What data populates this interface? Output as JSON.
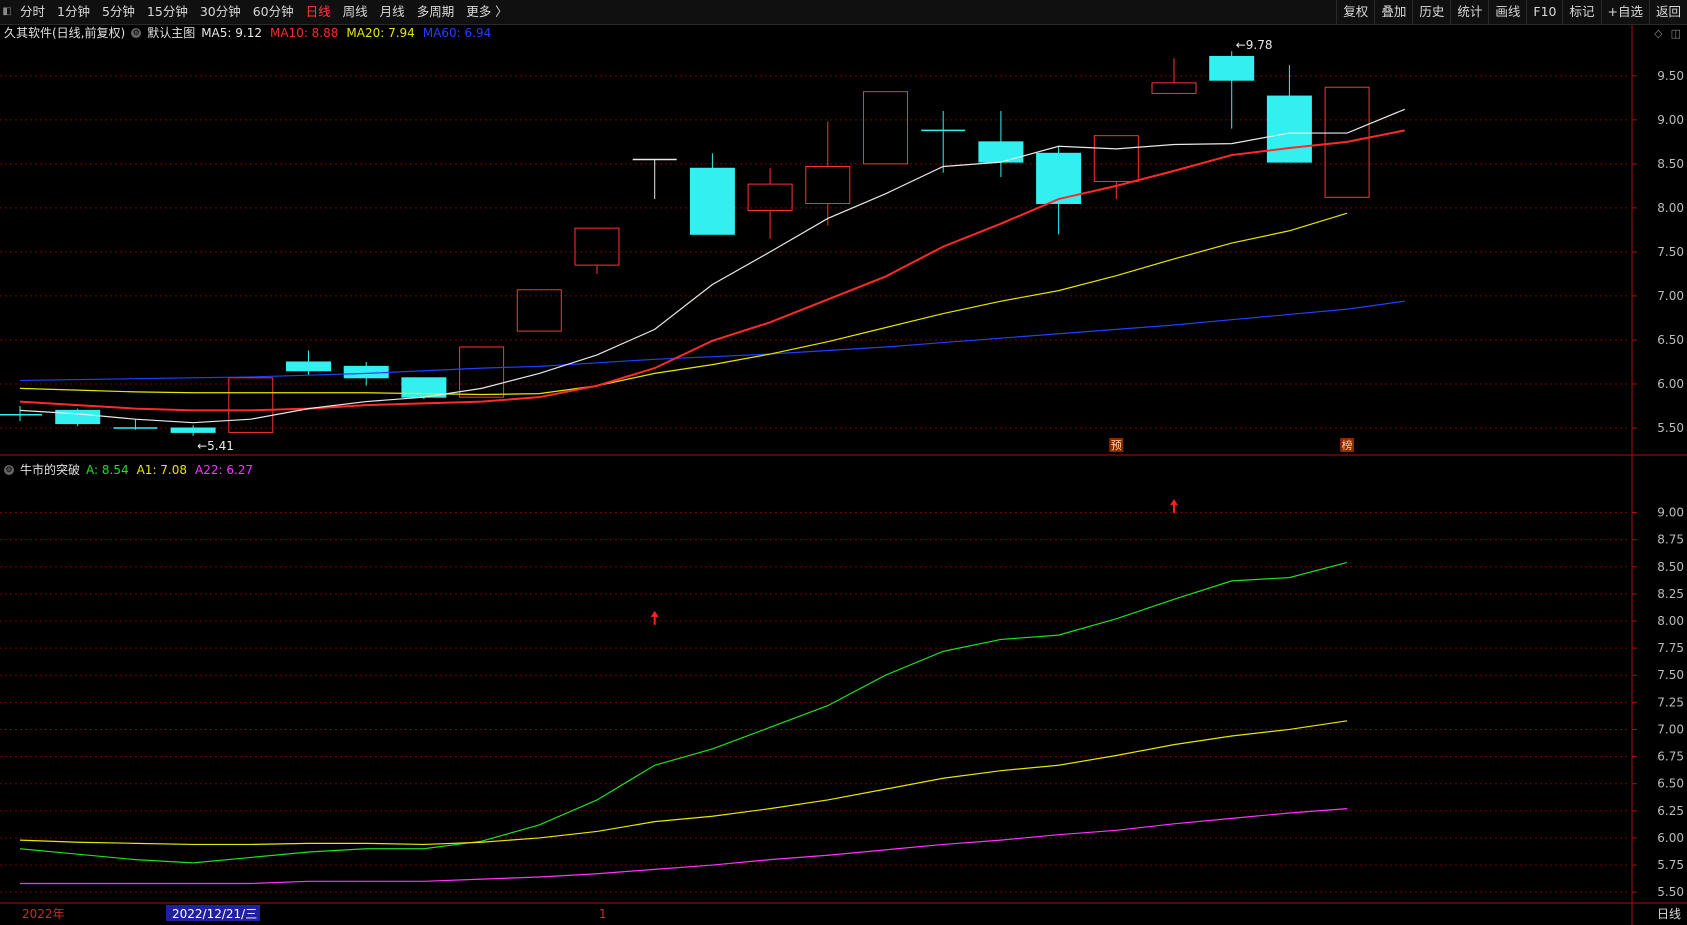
{
  "toolbar": {
    "left_items": [
      {
        "label": "分时",
        "active": false
      },
      {
        "label": "1分钟",
        "active": false
      },
      {
        "label": "5分钟",
        "active": false
      },
      {
        "label": "15分钟",
        "active": false
      },
      {
        "label": "30分钟",
        "active": false
      },
      {
        "label": "60分钟",
        "active": false
      },
      {
        "label": "日线",
        "active": true
      },
      {
        "label": "周线",
        "active": false
      },
      {
        "label": "月线",
        "active": false
      },
      {
        "label": "多周期",
        "active": false
      },
      {
        "label": "更多 〉",
        "active": false
      }
    ],
    "right_items": [
      "复权",
      "叠加",
      "历史",
      "统计",
      "画线",
      "F10",
      "标记",
      "+自选",
      "返回"
    ]
  },
  "main_legend": {
    "title": "久其软件(日线,前复权)",
    "template": "默认主图",
    "ma": [
      {
        "label": "MA5: 9.12",
        "color": "#e8e8e8"
      },
      {
        "label": "MA10: 8.88",
        "color": "#ff2a2a"
      },
      {
        "label": "MA20: 7.94",
        "color": "#e6e600"
      },
      {
        "label": "MA60: 6.94",
        "color": "#2040ff"
      }
    ]
  },
  "indicator_legend": {
    "title": "牛市的突破",
    "items": [
      {
        "label": "A: 8.54",
        "color": "#22dd22"
      },
      {
        "label": "A1: 7.08",
        "color": "#e6e600"
      },
      {
        "label": "A22: 6.27",
        "color": "#ff33ff"
      }
    ]
  },
  "bottom_period": "日线",
  "colors": {
    "up": "#ff3333",
    "down": "#33f0f0",
    "grid": "#7a0000",
    "axis": "#aa1010"
  },
  "chart_data": [
    {
      "type": "candlestick",
      "name": "main",
      "ylim": [
        5.25,
        9.85
      ],
      "yticks": [
        "9.50",
        "9.00",
        "8.50",
        "8.00",
        "7.50",
        "7.00",
        "6.50",
        "6.00",
        "5.50"
      ],
      "candles": [
        {
          "o": 5.65,
          "c": 5.65,
          "h": 5.75,
          "l": 5.58
        },
        {
          "o": 5.7,
          "c": 5.55,
          "h": 5.72,
          "l": 5.52
        },
        {
          "o": 5.5,
          "c": 5.5,
          "h": 5.6,
          "l": 5.48
        },
        {
          "o": 5.5,
          "c": 5.45,
          "h": 5.53,
          "l": 5.41
        },
        {
          "o": 5.45,
          "c": 6.07,
          "h": 6.07,
          "l": 5.45
        },
        {
          "o": 6.25,
          "c": 6.15,
          "h": 6.38,
          "l": 6.1
        },
        {
          "o": 6.2,
          "c": 6.07,
          "h": 6.25,
          "l": 5.98
        },
        {
          "o": 6.07,
          "c": 5.85,
          "h": 6.07,
          "l": 5.83
        },
        {
          "o": 5.85,
          "c": 6.42,
          "h": 6.42,
          "l": 5.85
        },
        {
          "o": 6.6,
          "c": 7.07,
          "h": 7.07,
          "l": 6.6
        },
        {
          "o": 7.35,
          "c": 7.77,
          "h": 7.77,
          "l": 7.25
        },
        {
          "o": 8.55,
          "c": 8.55,
          "h": 8.55,
          "l": 8.1
        },
        {
          "o": 8.45,
          "c": 7.7,
          "h": 8.62,
          "l": 7.7
        },
        {
          "o": 7.97,
          "c": 8.27,
          "h": 8.45,
          "l": 7.65
        },
        {
          "o": 8.05,
          "c": 8.47,
          "h": 8.98,
          "l": 7.8
        },
        {
          "o": 8.5,
          "c": 9.32,
          "h": 9.32,
          "l": 8.5
        },
        {
          "o": 8.88,
          "c": 8.88,
          "h": 9.1,
          "l": 8.4
        },
        {
          "o": 8.75,
          "c": 8.52,
          "h": 9.1,
          "l": 8.35
        },
        {
          "o": 8.62,
          "c": 8.05,
          "h": 8.7,
          "l": 7.7
        },
        {
          "o": 8.3,
          "c": 8.82,
          "h": 8.82,
          "l": 8.1
        },
        {
          "o": 9.3,
          "c": 9.42,
          "h": 9.7,
          "l": 9.3
        },
        {
          "o": 9.72,
          "c": 9.45,
          "h": 9.78,
          "l": 8.9
        },
        {
          "o": 9.27,
          "c": 8.52,
          "h": 9.62,
          "l": 8.52
        },
        {
          "o": 8.12,
          "c": 9.37,
          "h": 9.37,
          "l": 8.12
        }
      ],
      "ma5": [
        5.7,
        5.66,
        5.6,
        5.56,
        5.6,
        5.72,
        5.8,
        5.85,
        5.95,
        6.12,
        6.33,
        6.62,
        7.13,
        7.5,
        7.88,
        8.16,
        8.47,
        8.52,
        8.7,
        8.67,
        8.72,
        8.73,
        8.85,
        8.85,
        9.12
      ],
      "ma10": [
        5.8,
        5.76,
        5.72,
        5.7,
        5.7,
        5.72,
        5.76,
        5.78,
        5.8,
        5.85,
        5.98,
        6.18,
        6.49,
        6.7,
        6.96,
        7.22,
        7.56,
        7.82,
        8.1,
        8.25,
        8.42,
        8.6,
        8.68,
        8.75,
        8.88
      ],
      "ma20": [
        5.95,
        5.93,
        5.91,
        5.9,
        5.9,
        5.9,
        5.9,
        5.89,
        5.88,
        5.89,
        5.98,
        6.12,
        6.22,
        6.34,
        6.48,
        6.64,
        6.8,
        6.94,
        7.06,
        7.23,
        7.42,
        7.6,
        7.74,
        7.94
      ],
      "ma60": [
        6.04,
        6.05,
        6.06,
        6.07,
        6.08,
        6.1,
        6.12,
        6.15,
        6.18,
        6.2,
        6.24,
        6.28,
        6.31,
        6.34,
        6.38,
        6.42,
        6.47,
        6.52,
        6.57,
        6.62,
        6.67,
        6.73,
        6.79,
        6.85,
        6.94
      ],
      "annotations": [
        {
          "index": 3,
          "price": 5.41,
          "text": "←5.41",
          "side": "low"
        },
        {
          "index": 21,
          "price": 9.78,
          "text": "←9.78",
          "side": "high"
        }
      ],
      "markers": [
        {
          "index": 19,
          "text": "预"
        },
        {
          "index": 23,
          "text": "榜"
        }
      ]
    },
    {
      "type": "line",
      "name": "indicator",
      "ylim": [
        5.4,
        9.3
      ],
      "yticks": [
        "9.00",
        "8.75",
        "8.50",
        "8.25",
        "8.00",
        "7.75",
        "7.50",
        "7.25",
        "7.00",
        "6.75",
        "6.50",
        "6.25",
        "6.00",
        "5.75",
        "5.50"
      ],
      "series": [
        {
          "name": "A",
          "color": "#22dd22",
          "values": [
            5.9,
            5.85,
            5.8,
            5.77,
            5.82,
            5.87,
            5.9,
            5.9,
            5.97,
            6.12,
            6.35,
            6.67,
            6.82,
            7.02,
            7.22,
            7.5,
            7.72,
            7.83,
            7.87,
            8.02,
            8.2,
            8.37,
            8.4,
            8.54
          ]
        },
        {
          "name": "A1",
          "color": "#e6e600",
          "values": [
            5.98,
            5.96,
            5.95,
            5.94,
            5.94,
            5.95,
            5.95,
            5.94,
            5.96,
            6.0,
            6.06,
            6.15,
            6.2,
            6.27,
            6.35,
            6.45,
            6.55,
            6.62,
            6.67,
            6.76,
            6.86,
            6.94,
            7.0,
            7.08
          ]
        },
        {
          "name": "A22",
          "color": "#ff33ff",
          "values": [
            5.58,
            5.58,
            5.58,
            5.58,
            5.58,
            5.6,
            5.6,
            5.6,
            5.62,
            5.64,
            5.67,
            5.71,
            5.75,
            5.8,
            5.84,
            5.89,
            5.94,
            5.98,
            6.03,
            6.07,
            6.13,
            6.18,
            6.23,
            6.27
          ]
        }
      ],
      "arrows": [
        {
          "index": 11,
          "value": 8.02
        },
        {
          "index": 20,
          "value": 9.05
        }
      ]
    }
  ],
  "x_axis": {
    "labels": [
      {
        "index": 0,
        "text": "2022年",
        "highlight": false
      },
      {
        "index": 2.6,
        "text": "2022/12/21/三",
        "highlight": true
      },
      {
        "index": 10,
        "text": "1",
        "highlight": false
      }
    ]
  }
}
